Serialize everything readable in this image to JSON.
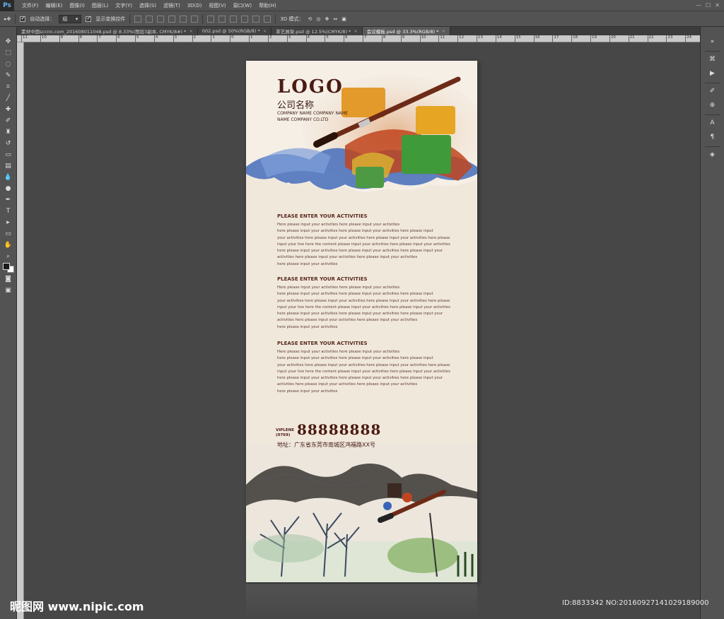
{
  "app": {
    "logo": "Ps",
    "menu": [
      "文件(F)",
      "编辑(E)",
      "图像(I)",
      "图层(L)",
      "文字(Y)",
      "选择(S)",
      "滤镜(T)",
      "3D(D)",
      "视图(V)",
      "窗口(W)",
      "帮助(H)"
    ]
  },
  "options": {
    "auto_select_label": "自动选择：",
    "auto_select_value": "组",
    "show_transform_label": "显示变换控件",
    "mode_3d_label": "3D 模式："
  },
  "tabs": [
    {
      "label": "素材中国sccnn.com_201608011048.psd @ 8.33%(图层3副本, CMYK/8#) *",
      "active": false
    },
    {
      "label": "002.psd @ 50%(RGB/8) *",
      "active": false
    },
    {
      "label": "茶艺展架.psd @ 12.5%(CMYK/8) *",
      "active": false
    },
    {
      "label": "会议模板.psd @ 33.3%(RGB/8) *",
      "active": true
    }
  ],
  "ruler": {
    "ticks": [
      "11",
      "10",
      "9",
      "8",
      "7",
      "6",
      "5",
      "4",
      "3",
      "2",
      "1",
      "0",
      "1",
      "2",
      "3",
      "4",
      "5",
      "6",
      "7",
      "8",
      "9",
      "10",
      "11",
      "12",
      "13",
      "14",
      "15",
      "16",
      "17",
      "18",
      "19",
      "20",
      "21",
      "22",
      "23",
      "24"
    ]
  },
  "document": {
    "logo": "LOGO",
    "company_cn": "公司名称",
    "company_en_1": "COMPANY NAME COMPANY NAME",
    "company_en_2": "NAME COMPANY CO.LTD",
    "sections": [
      {
        "title": "PLEASE ENTER YOUR ACTIVITIES",
        "lines": [
          "Here please input your activities here please input your activities",
          "here please input your activities here please input your activities here please input",
          "your activities here please input your activities here please input your activities here please",
          "input your live here the content please input your activities here please input your activities",
          "here please input your activities here please input your activities here please input your",
          " activities here please input your activities here please input your activities",
          "here please input your activities"
        ]
      },
      {
        "title": "PLEASE ENTER YOUR ACTIVITIES",
        "lines": [
          "Here please input your activities here please input your activities",
          "here please input your activities here please input your activities here please input",
          "your activities here please input your activities here please input your activities here please",
          "input your live here the content please input your activities here please input your activities",
          "here please input your activities here please input your activities here please input your",
          " activities here please input your activities here please input your activities",
          "here please input your activities"
        ]
      },
      {
        "title": "PLEASE ENTER YOUR ACTIVITIES",
        "lines": [
          "Here please input your activities here please input your activities",
          "here please input your activities here please input your activities here please input",
          "your activities here please input your activities here please input your activities here please",
          "input your live here the content please input your activities here please input your activities",
          "here please input your activities here please input your activities here please input your",
          " activities here please input your activities here please input your activities",
          "here please input your activities"
        ]
      }
    ],
    "hotline_label": "VIPLENE",
    "hotline_code": "(0769)",
    "hotline_number": "88888888",
    "address": "地址：广东省东莞市南城区鸿福路XX号"
  },
  "watermark": {
    "site": "昵图网 www.nipic.com",
    "id": "ID:8833342 NO:20160927141029189000"
  },
  "colors": {
    "brown_text": "#4a1b12",
    "paper": "#f1e8dc",
    "ps_bg": "#454545"
  }
}
